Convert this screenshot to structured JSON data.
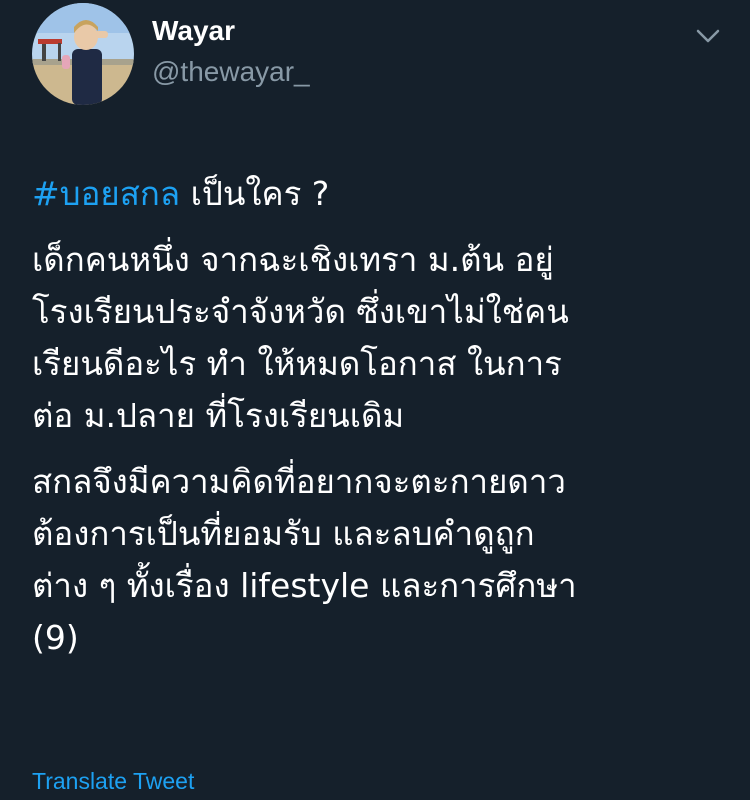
{
  "author": {
    "display_name": "Wayar",
    "handle": "@thewayar_"
  },
  "icons": {
    "more": "chevron-down-icon",
    "avatar": "profile-photo"
  },
  "tweet": {
    "hashtag": "#บอยสกล",
    "headline_rest": " เป็นใคร ?",
    "paragraph1": [
      "เด็กคนหนึ่ง จากฉะเชิงเทรา ม.ต้น อยู่",
      "โรงเรียนประจำจังหวัด ซึ่งเขาไม่ใช่คน",
      "เรียนดีอะไร ทำ ให้หมดโอกาส ในการ",
      "ต่อ ม.ปลาย ที่โรงเรียนเดิม"
    ],
    "paragraph2": [
      "สกลจึงมีความคิดที่อยากจะตะกายดาว",
      "ต้องการเป็นที่ยอมรับ และลบคำดูถูก",
      "ต่าง ๆ ทั้งเรื่อง lifestyle และการศึกษา",
      "(9)"
    ]
  },
  "translate_label": "Translate Tweet",
  "colors": {
    "background": "#15202b",
    "text": "#ffffff",
    "secondary": "#8899a6",
    "accent": "#1da1f2"
  }
}
